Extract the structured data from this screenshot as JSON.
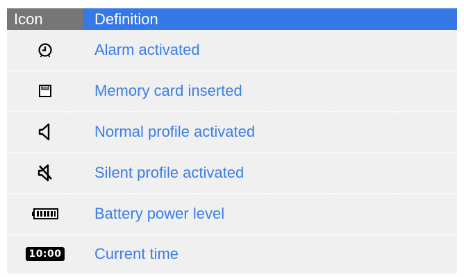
{
  "table": {
    "header": {
      "icon_label": "Icon",
      "definition_label": "Definition"
    },
    "rows": [
      {
        "icon": "alarm-clock-icon",
        "definition": "Alarm activated"
      },
      {
        "icon": "memory-card-icon",
        "definition": "Memory card inserted"
      },
      {
        "icon": "speaker-icon",
        "definition": "Normal profile activated"
      },
      {
        "icon": "speaker-muted-icon",
        "definition": "Silent profile activated"
      },
      {
        "icon": "battery-icon",
        "definition": "Battery power level"
      },
      {
        "icon": "time-badge",
        "time_text": "10:00",
        "definition": "Current time"
      }
    ]
  },
  "colors": {
    "header_icon_bg": "#767676",
    "header_definition_bg": "#3578e6",
    "row_bg": "#f0f0f0",
    "definition_text": "#3a7ee8"
  }
}
